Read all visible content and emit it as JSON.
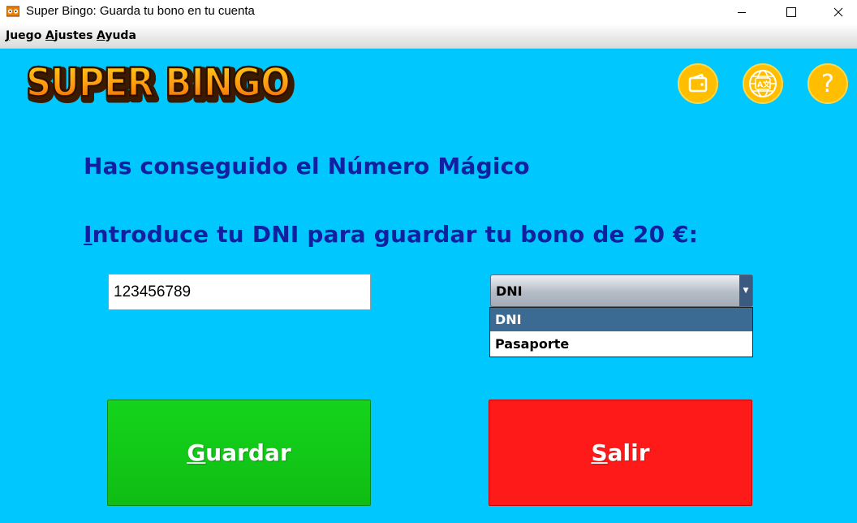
{
  "window": {
    "title": "Super Bingo: Guarda tu bono en tu cuenta",
    "minimize_icon": "minimize-icon",
    "maximize_icon": "maximize-icon",
    "close_icon": "close-icon"
  },
  "menu": {
    "items": [
      {
        "accel": "J",
        "rest": "uego"
      },
      {
        "accel": "A",
        "rest": "justes"
      },
      {
        "accel": "A",
        "rest": "yuda"
      }
    ]
  },
  "logo": {
    "text": "SUPER BINGO"
  },
  "toolbar": {
    "icons": [
      "wallet-icon",
      "language-globe-icon",
      "help-icon"
    ]
  },
  "main": {
    "heading1": "Has conseguido el Número Mágico",
    "heading2_accel": "I",
    "heading2_rest": "ntroduce tu DNI para guardar tu bono de 20 €:",
    "dni_value": "123456789",
    "doc_type": {
      "selected": "DNI",
      "options": [
        "DNI",
        "Pasaporte"
      ]
    },
    "save_accel": "G",
    "save_rest": "uardar",
    "exit_accel": "S",
    "exit_rest": "alir"
  },
  "colors": {
    "background": "#00c8ff",
    "heading": "#1020a0",
    "save_button": "#12c818",
    "exit_button": "#ff1a1a",
    "icon_yellow": "#ffbe00",
    "selected_option": "#3b6a93"
  }
}
